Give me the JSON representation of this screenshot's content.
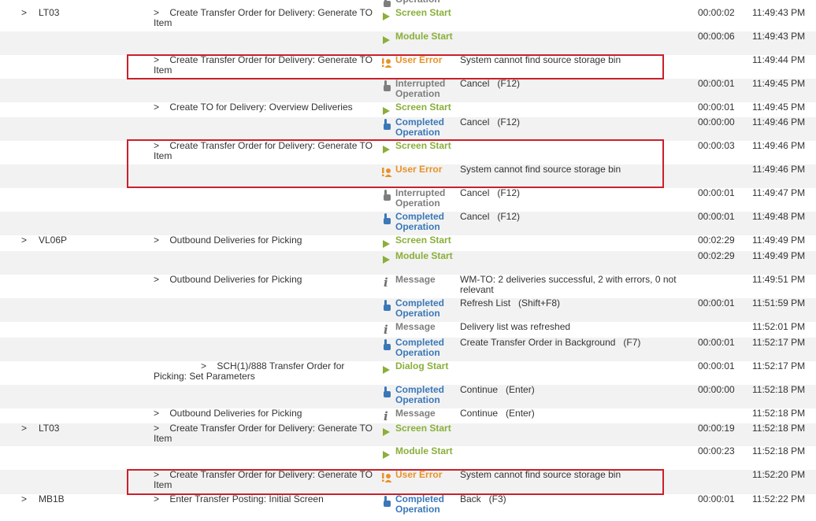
{
  "rows": [
    {
      "expander": "",
      "tcode": "",
      "name": "",
      "type": "Operation",
      "typeKind": "interr",
      "icon": "interrupted-icon",
      "desc": "",
      "duration": "",
      "time": ""
    },
    {
      "expander": ">",
      "tcode": "LT03",
      "name": ">    Create Transfer Order for Delivery: Generate TO Item",
      "type": "Screen Start",
      "typeKind": "start",
      "icon": "play-icon",
      "desc": "",
      "duration": "00:00:02",
      "time": "11:49:43 PM"
    },
    {
      "expander": "",
      "tcode": "",
      "name": "",
      "type": "Module Start",
      "typeKind": "start",
      "icon": "play-icon",
      "desc": "",
      "duration": "00:00:06",
      "time": "11:49:43 PM"
    },
    {
      "expander": "",
      "tcode": "",
      "name": ">    Create Transfer Order for Delivery: Generate TO Item",
      "type": "User Error",
      "typeKind": "error",
      "icon": "user-error-icon",
      "desc": "System cannot find source storage bin",
      "duration": "",
      "time": "11:49:44 PM"
    },
    {
      "expander": "",
      "tcode": "",
      "name": "",
      "type": "Interrupted Operation",
      "typeKind": "interr",
      "icon": "interrupted-icon",
      "desc": "Cancel   (F12)",
      "duration": "00:00:01",
      "time": "11:49:45 PM"
    },
    {
      "expander": "",
      "tcode": "",
      "name": ">    Create TO for Delivery: Overview Deliveries",
      "type": "Screen Start",
      "typeKind": "start",
      "icon": "play-icon",
      "desc": "",
      "duration": "00:00:01",
      "time": "11:49:45 PM"
    },
    {
      "expander": "",
      "tcode": "",
      "name": "",
      "type": "Completed Operation",
      "typeKind": "comp",
      "icon": "completed-icon",
      "desc": "Cancel   (F12)",
      "duration": "00:00:00",
      "time": "11:49:46 PM"
    },
    {
      "expander": "",
      "tcode": "",
      "name": ">    Create Transfer Order for Delivery: Generate TO Item",
      "type": "Screen Start",
      "typeKind": "start",
      "icon": "play-icon",
      "desc": "",
      "duration": "00:00:03",
      "time": "11:49:46 PM"
    },
    {
      "expander": "",
      "tcode": "",
      "name": "",
      "type": "User Error",
      "typeKind": "error",
      "icon": "user-error-icon",
      "desc": "System cannot find source storage bin",
      "duration": "",
      "time": "11:49:46 PM"
    },
    {
      "expander": "",
      "tcode": "",
      "name": "",
      "type": "Interrupted Operation",
      "typeKind": "interr",
      "icon": "interrupted-icon",
      "desc": "Cancel   (F12)",
      "duration": "00:00:01",
      "time": "11:49:47 PM"
    },
    {
      "expander": "",
      "tcode": "",
      "name": "",
      "type": "Completed Operation",
      "typeKind": "comp",
      "icon": "completed-icon",
      "desc": "Cancel   (F12)",
      "duration": "00:00:01",
      "time": "11:49:48 PM"
    },
    {
      "expander": ">",
      "tcode": "VL06P",
      "name": ">    Outbound Deliveries for Picking",
      "type": "Screen Start",
      "typeKind": "start",
      "icon": "play-icon",
      "desc": "",
      "duration": "00:02:29",
      "time": "11:49:49 PM"
    },
    {
      "expander": "",
      "tcode": "",
      "name": "",
      "type": "Module Start",
      "typeKind": "start",
      "icon": "play-icon",
      "desc": "",
      "duration": "00:02:29",
      "time": "11:49:49 PM"
    },
    {
      "expander": "",
      "tcode": "",
      "name": ">    Outbound Deliveries for Picking",
      "type": "Message",
      "typeKind": "message",
      "icon": "info-icon",
      "desc": "WM-TO: 2 deliveries successful, 2 with errors, 0 not relevant",
      "duration": "",
      "time": "11:49:51 PM"
    },
    {
      "expander": "",
      "tcode": "",
      "name": "",
      "type": "Completed Operation",
      "typeKind": "comp",
      "icon": "completed-icon",
      "desc": "Refresh List   (Shift+F8)",
      "duration": "00:00:01",
      "time": "11:51:59 PM"
    },
    {
      "expander": "",
      "tcode": "",
      "name": "",
      "type": "Message",
      "typeKind": "message",
      "icon": "info-icon",
      "desc": "Delivery list was refreshed",
      "duration": "",
      "time": "11:52:01 PM"
    },
    {
      "expander": "",
      "tcode": "",
      "name": "",
      "type": "Completed Operation",
      "typeKind": "comp",
      "icon": "completed-icon",
      "desc": "Create Transfer Order in Background   (F7)",
      "duration": "00:00:01",
      "time": "11:52:17 PM"
    },
    {
      "expander": "",
      "tcode": "",
      "name": "                  >    SCH(1)/888 Transfer Order for Picking: Set Parameters",
      "type": "Dialog Start",
      "typeKind": "start",
      "icon": "play-icon",
      "desc": "",
      "duration": "00:00:01",
      "time": "11:52:17 PM"
    },
    {
      "expander": "",
      "tcode": "",
      "name": "",
      "type": "Completed Operation",
      "typeKind": "comp",
      "icon": "completed-icon",
      "desc": "Continue   (Enter)",
      "duration": "00:00:00",
      "time": "11:52:18 PM"
    },
    {
      "expander": "",
      "tcode": "",
      "name": ">    Outbound Deliveries for Picking",
      "type": "Message",
      "typeKind": "message",
      "icon": "info-icon",
      "desc": "Continue   (Enter)",
      "duration": "",
      "time": "11:52:18 PM"
    },
    {
      "expander": ">",
      "tcode": "LT03",
      "name": ">    Create Transfer Order for Delivery: Generate TO Item",
      "type": "Screen Start",
      "typeKind": "start",
      "icon": "play-icon",
      "desc": "",
      "duration": "00:00:19",
      "time": "11:52:18 PM"
    },
    {
      "expander": "",
      "tcode": "",
      "name": "",
      "type": "Module Start",
      "typeKind": "start",
      "icon": "play-icon",
      "desc": "",
      "duration": "00:00:23",
      "time": "11:52:18 PM"
    },
    {
      "expander": "",
      "tcode": "",
      "name": ">    Create Transfer Order for Delivery: Generate TO Item",
      "type": "User Error",
      "typeKind": "error",
      "icon": "user-error-icon",
      "desc": "System cannot find source storage bin",
      "duration": "",
      "time": "11:52:20 PM"
    },
    {
      "expander": ">",
      "tcode": "MB1B",
      "name": ">    Enter Transfer Posting: Initial Screen",
      "type": "Completed Operation",
      "typeKind": "comp",
      "icon": "completed-icon",
      "desc": "Back   (F3)",
      "duration": "00:00:01",
      "time": "11:52:22 PM"
    }
  ],
  "colors": {
    "screen_start": "#8aaf3a",
    "user_error": "#e8922a",
    "interrupted": "#7e7e7e",
    "completed": "#3a78b8",
    "message": "#7e7e7e",
    "highlight": "#cc1f2a",
    "row_shade": "#f2f2f2"
  }
}
